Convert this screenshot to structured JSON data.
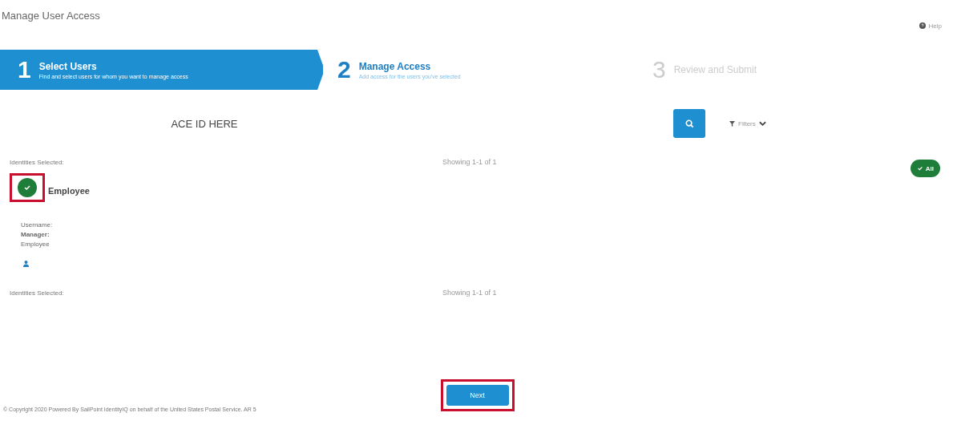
{
  "page": {
    "title": "Manage User Access",
    "help": "Help"
  },
  "steps": [
    {
      "number": "1",
      "title": "Select Users",
      "subtitle": "Find and select users for whom you want to manage access",
      "selected": true,
      "disabled": false
    },
    {
      "number": "2",
      "title": "Manage Access",
      "subtitle": "Add access for the users you've selected",
      "selected": false,
      "disabled": false
    },
    {
      "number": "3",
      "title": "Review and Submit",
      "selected": false,
      "disabled": true
    }
  ],
  "search": {
    "label": "ACE ID HERE"
  },
  "filters": {
    "label": "Filters"
  },
  "results_top": {
    "identities_label": "Identities Selected:",
    "showing": "Showing 1-1 of 1"
  },
  "select_all": {
    "label": "All",
    "checked": true
  },
  "identity": {
    "checked": true,
    "highlighted": true,
    "type": "Employee",
    "username_label": "Username:",
    "manager_label": "Manager:",
    "role": "Employee"
  },
  "results_bottom": {
    "identities_label": "Identities Selected:",
    "showing": "Showing 1-1 of 1"
  },
  "next_button": {
    "label": "Next",
    "highlighted": true
  },
  "footer": "© Copyright 2020 Powered By SailPoint IdentityIQ on behalf of the United States Postal Service. AR 5"
}
